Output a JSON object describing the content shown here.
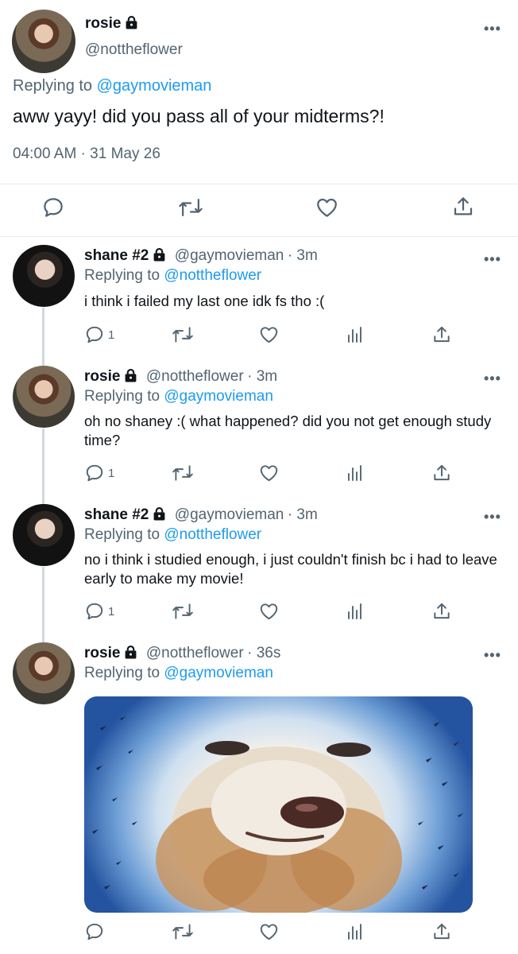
{
  "main_tweet": {
    "name": "rosie",
    "handle": "@nottheflower",
    "replying_prefix": "Replying to ",
    "replying_to": "@gaymovieman",
    "text": "aww yayy! did you pass all of your midterms?!",
    "timestamp": "04:00 AM · 31 May 26",
    "actions": [
      "reply-icon",
      "retweet-icon",
      "like-icon",
      "share-icon"
    ]
  },
  "replies": [
    {
      "name": "shane #2",
      "handle": "@gaymovieman",
      "time": "· 3m",
      "replying_prefix": "Replying to ",
      "replying_to": "@nottheflower",
      "text": "i think i failed my last one idk fs tho :(",
      "reply_count": "1"
    },
    {
      "name": "rosie",
      "handle": "@nottheflower",
      "time": "· 3m",
      "replying_prefix": "Replying to ",
      "replying_to": "@gaymovieman",
      "text": "oh no shaney :( what happened? did you not get enough study time?",
      "reply_count": "1"
    },
    {
      "name": "shane #2",
      "handle": "@gaymovieman",
      "time": "· 3m",
      "replying_prefix": "Replying to ",
      "replying_to": "@nottheflower",
      "text": "no i think i studied enough, i just couldn't finish bc i had to leave early to make my movie!",
      "reply_count": "1"
    },
    {
      "name": "rosie",
      "handle": "@nottheflower",
      "time": "· 36s",
      "replying_prefix": "Replying to ",
      "replying_to": "@gaymovieman",
      "media": "dog-face-meme-image"
    }
  ],
  "more_label": "•••",
  "colors": {
    "link": "#1d9bf0",
    "secondary": "#536471",
    "divider": "#e6ecf0"
  }
}
